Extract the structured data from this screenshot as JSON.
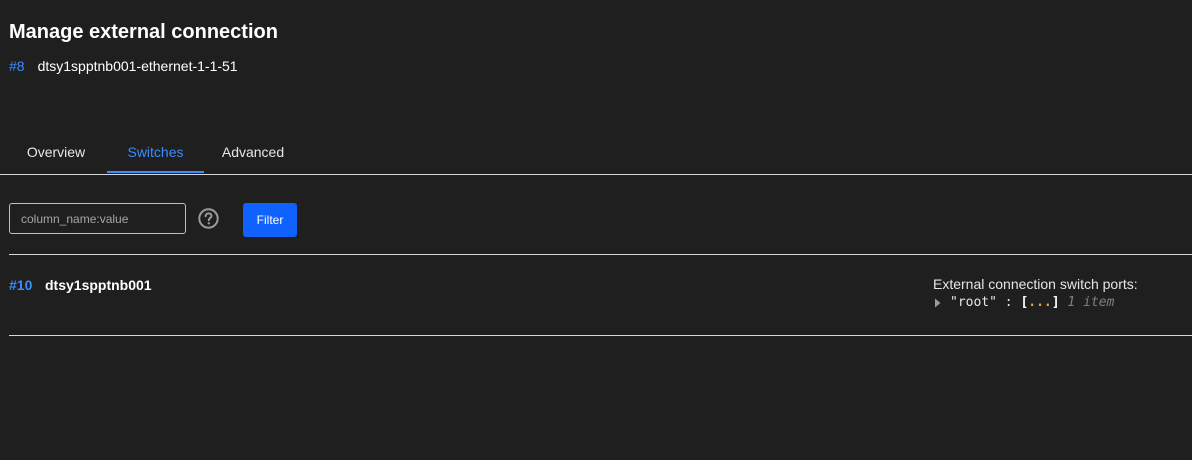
{
  "header": {
    "title": "Manage external connection",
    "connection_id": "#8",
    "connection_name": "dtsy1spptnb001-ethernet-1-1-51"
  },
  "tabs": [
    {
      "label": "Overview",
      "active": false
    },
    {
      "label": "Switches",
      "active": true
    },
    {
      "label": "Advanced",
      "active": false
    }
  ],
  "filter": {
    "placeholder": "column_name:value",
    "value": "",
    "button_label": "Filter",
    "help_icon": "question-circle-icon"
  },
  "rows": [
    {
      "id": "#10",
      "name": "dtsy1spptnb001",
      "ports_label": "External connection switch ports:",
      "json": {
        "key": "\"root\"",
        "colon": ":",
        "open_bracket": "[",
        "ellipsis": "...",
        "close_bracket": "]",
        "count": "1 item"
      }
    }
  ],
  "colors": {
    "background": "#1f1f1f",
    "accent": "#3b8cff",
    "button": "#0f62fe",
    "ellipsis": "#e8a33d"
  }
}
